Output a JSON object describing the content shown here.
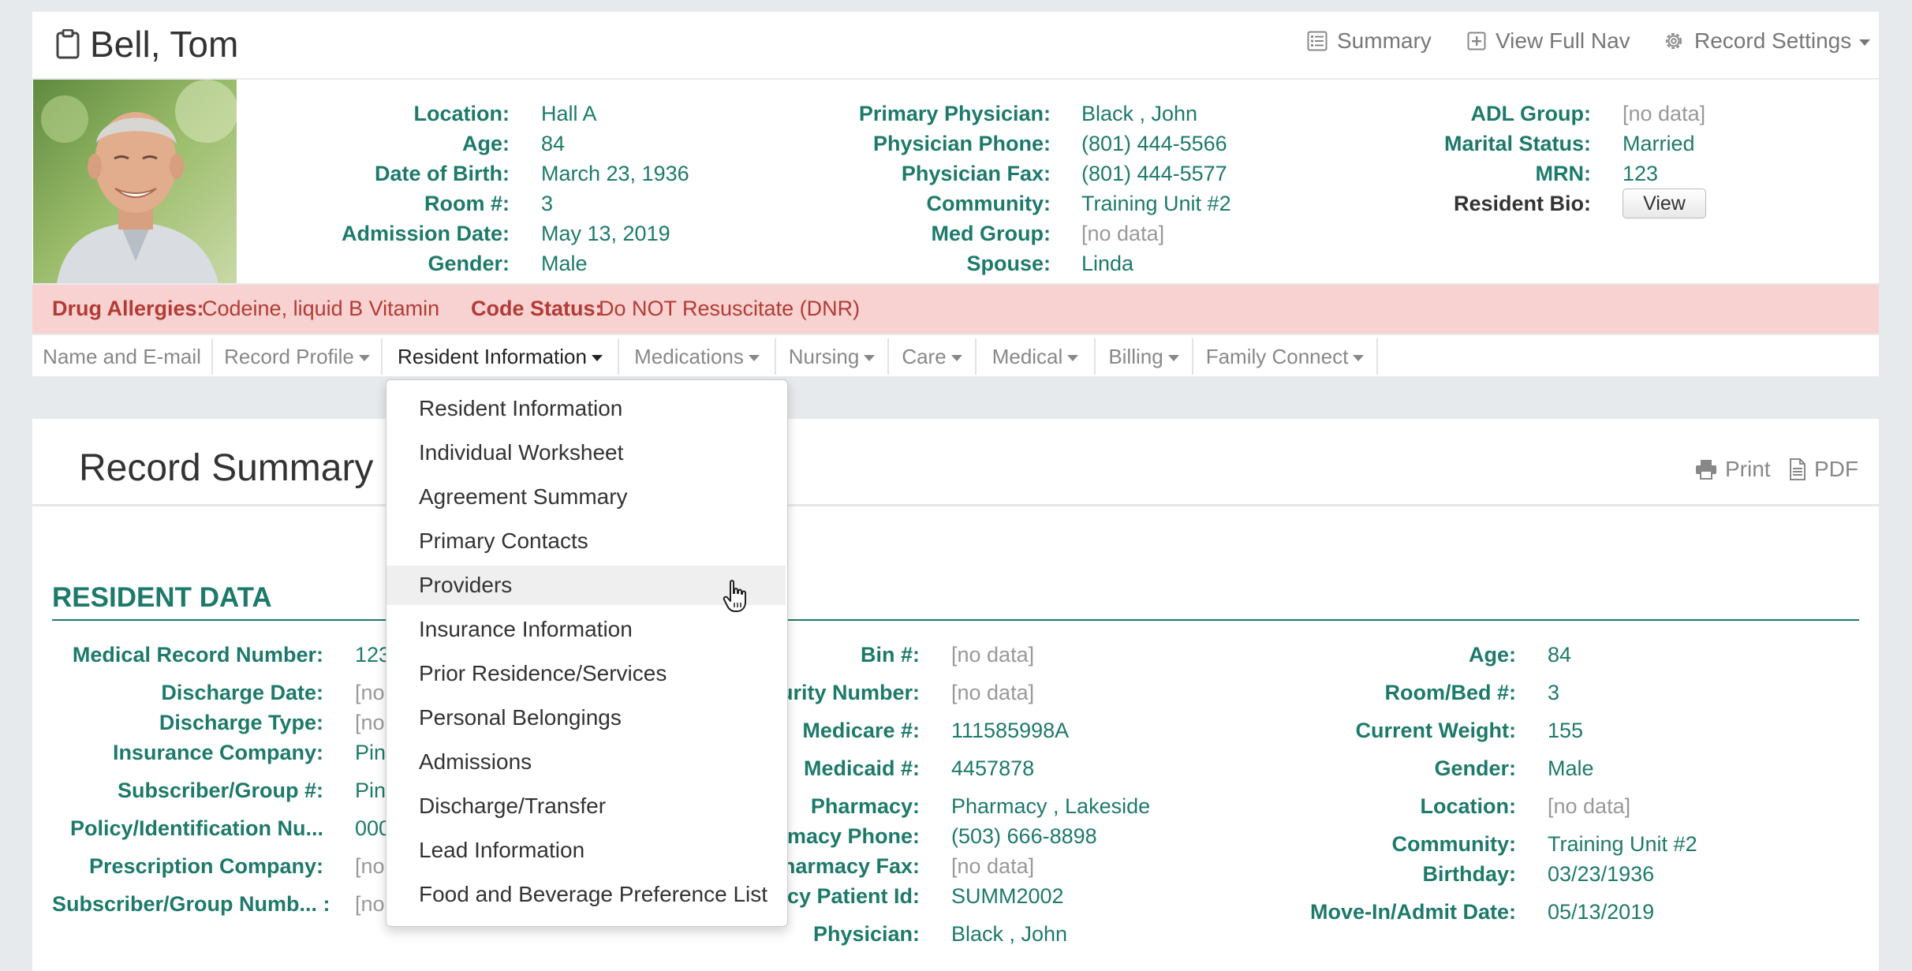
{
  "header": {
    "resident_name": "Bell, Tom",
    "summary_link": "Summary",
    "full_nav_link": "View Full Nav",
    "record_settings_link": "Record Settings"
  },
  "info": {
    "col1": [
      {
        "label": "Location:",
        "value": "Hall A"
      },
      {
        "label": "Age:",
        "value": "84"
      },
      {
        "label": "Date of Birth:",
        "value": "March 23, 1936"
      },
      {
        "label": "Room #:",
        "value": "3"
      },
      {
        "label": "Admission Date:",
        "value": "May 13, 2019"
      },
      {
        "label": "Gender:",
        "value": "Male"
      }
    ],
    "col2": [
      {
        "label": "Primary Physician:",
        "value": "Black , John"
      },
      {
        "label": "Physician Phone:",
        "value": "(801) 444-5566"
      },
      {
        "label": "Physician Fax:",
        "value": "(801) 444-5577"
      },
      {
        "label": "Community:",
        "value": "Training Unit #2"
      },
      {
        "label": "Med Group:",
        "value": "[no data]"
      },
      {
        "label": "Spouse:",
        "value": "Linda"
      }
    ],
    "col3": [
      {
        "label": "ADL Group:",
        "value": "[no data]"
      },
      {
        "label": "Marital Status:",
        "value": "Married"
      },
      {
        "label": "MRN:",
        "value": "123"
      },
      {
        "label": "Resident Bio:",
        "value": ""
      }
    ],
    "bio_button": "View"
  },
  "alerts": {
    "drug_allergies_label": "Drug Allergies:",
    "drug_allergies_value": "Codeine, liquid B Vitamin",
    "code_status_label": "Code Status:",
    "code_status_value": "Do NOT Resuscitate (DNR)"
  },
  "nav": {
    "tabs": [
      {
        "label": "Name and E-mail"
      },
      {
        "label": "Record Profile"
      },
      {
        "label": "Resident Information"
      },
      {
        "label": "Medications"
      },
      {
        "label": "Nursing"
      },
      {
        "label": "Care"
      },
      {
        "label": "Medical"
      },
      {
        "label": "Billing"
      },
      {
        "label": "Family Connect"
      }
    ],
    "active": "Resident Information"
  },
  "summary": {
    "title": "Record Summary",
    "print_label": "Print",
    "pdf_label": "PDF",
    "section_title": "RESIDENT DATA",
    "col1": [
      {
        "label": "Medical Record Number:",
        "value": "123"
      },
      {
        "label": "Discharge Date:",
        "value": "[no"
      },
      {
        "label": "Discharge Type:",
        "value": "[no"
      },
      {
        "label": "Insurance Company:",
        "value": "Pin"
      },
      {
        "label": "Subscriber/Group #:",
        "value": "Pin"
      },
      {
        "label": "Policy/Identification Nu...",
        "value": "000"
      },
      {
        "label": "Prescription Company:",
        "value": "[no"
      },
      {
        "label": "Subscriber/Group Numb... :",
        "value": "[no"
      }
    ],
    "col2": [
      {
        "label": "Bin #:",
        "value": "[no data]"
      },
      {
        "label": "urity Number:",
        "value": "[no data]"
      },
      {
        "label": "Medicare #:",
        "value": "111585998A"
      },
      {
        "label": "Medicaid #:",
        "value": "4457878"
      },
      {
        "label": "Pharmacy:",
        "value": "Pharmacy , Lakeside"
      },
      {
        "label": "armacy Phone:",
        "value": "(503) 666-8898"
      },
      {
        "label": "Pharmacy Fax:",
        "value": "[no data]"
      },
      {
        "label": "acy Patient Id:",
        "value": "SUMM2002"
      },
      {
        "label": "Physician:",
        "value": "Black , John"
      }
    ],
    "col3": [
      {
        "label": "Age:",
        "value": "84"
      },
      {
        "label": "Room/Bed #:",
        "value": "3"
      },
      {
        "label": "Current Weight:",
        "value": "155"
      },
      {
        "label": "Gender:",
        "value": "Male"
      },
      {
        "label": "Location:",
        "value": "[no data]"
      },
      {
        "label": "Community:",
        "value": "Training Unit #2"
      },
      {
        "label": "Birthday:",
        "value": "03/23/1936"
      },
      {
        "label": "Move-In/Admit Date:",
        "value": "05/13/2019"
      }
    ]
  },
  "dropdown": {
    "items": [
      "Resident Information",
      "Individual Worksheet",
      "Agreement Summary",
      "Primary Contacts",
      "Providers",
      "Insurance Information",
      "Prior Residence/Services",
      "Personal Belongings",
      "Admissions",
      "Discharge/Transfer",
      "Lead Information",
      "Food and Beverage Preference List"
    ],
    "hovered": "Providers"
  },
  "colors": {
    "accent": "#1d7a6b",
    "alert_bg": "#f8d2d0",
    "alert_text": "#b23b36",
    "no_data": "#999999"
  },
  "icons": {
    "title": "clipboard-icon",
    "summary": "list-icon",
    "full_nav": "plus-square-icon",
    "settings": "gear-icon",
    "print": "printer-icon",
    "pdf": "document-icon",
    "cursor": "hand-pointer-icon"
  }
}
